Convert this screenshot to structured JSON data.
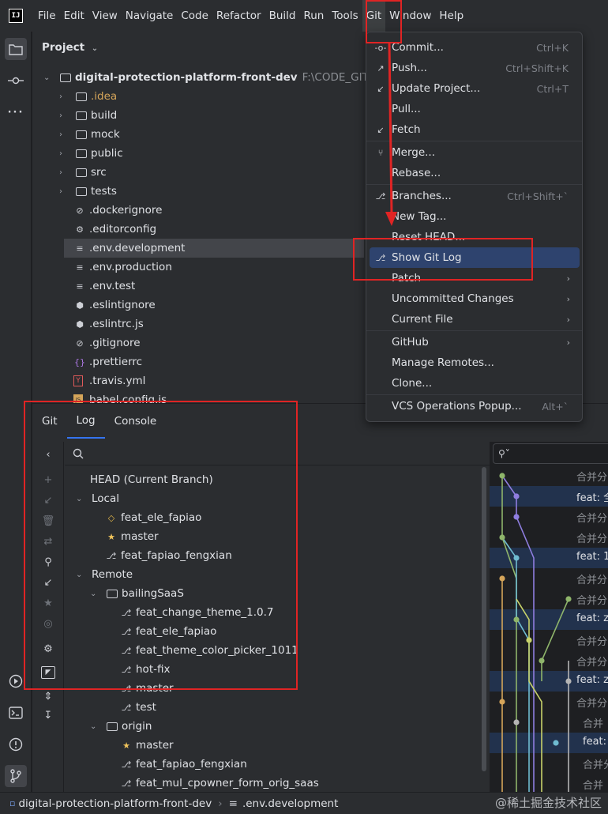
{
  "menubar": {
    "logo": "IJ",
    "items": [
      "File",
      "Edit",
      "View",
      "Navigate",
      "Code",
      "Refactor",
      "Build",
      "Run",
      "Tools",
      "Git",
      "Window",
      "Help"
    ]
  },
  "project": {
    "title": "Project",
    "root_name": "digital-protection-platform-front-dev",
    "root_path": "F:\\CODE_GIT\\SaaS-fe",
    "items": [
      {
        "name": ".idea",
        "type": "folder",
        "color": "#d5a55a"
      },
      {
        "name": "build",
        "type": "folder"
      },
      {
        "name": "mock",
        "type": "folder"
      },
      {
        "name": "public",
        "type": "folder"
      },
      {
        "name": "src",
        "type": "folder"
      },
      {
        "name": "tests",
        "type": "folder"
      },
      {
        "name": ".dockerignore",
        "type": "ignore"
      },
      {
        "name": ".editorconfig",
        "type": "gear"
      },
      {
        "name": ".env.development",
        "type": "text",
        "selected": true
      },
      {
        "name": ".env.production",
        "type": "text"
      },
      {
        "name": ".env.test",
        "type": "text"
      },
      {
        "name": ".eslintignore",
        "type": "eslint"
      },
      {
        "name": ".eslintrc.js",
        "type": "eslint"
      },
      {
        "name": ".gitignore",
        "type": "ignore"
      },
      {
        "name": ".prettierrc",
        "type": "braces"
      },
      {
        "name": ".travis.yml",
        "type": "yaml"
      },
      {
        "name": "babel.config.js",
        "type": "js"
      }
    ]
  },
  "git_menu": {
    "items": [
      {
        "label": "Commit...",
        "shortcut": "Ctrl+K",
        "icon": "commit-icon"
      },
      {
        "label": "Push...",
        "shortcut": "Ctrl+Shift+K",
        "icon": "push-icon"
      },
      {
        "label": "Update Project...",
        "shortcut": "Ctrl+T",
        "icon": "update-icon"
      },
      {
        "label": "Pull...",
        "shortcut": ""
      },
      {
        "label": "Fetch",
        "shortcut": "",
        "icon": "fetch-icon"
      },
      {
        "label": "Merge...",
        "shortcut": "",
        "icon": "merge-icon"
      },
      {
        "label": "Rebase...",
        "shortcut": ""
      },
      {
        "label": "Branches...",
        "shortcut": "Ctrl+Shift+`",
        "icon": "branch-icon"
      },
      {
        "label": "New Tag...",
        "shortcut": ""
      },
      {
        "label": "Reset HEAD...",
        "shortcut": ""
      },
      {
        "label": "Show Git Log",
        "shortcut": "",
        "icon": "branch-icon",
        "highlighted": true
      },
      {
        "label": "Patch",
        "submenu": true
      },
      {
        "label": "Uncommitted Changes",
        "submenu": true
      },
      {
        "label": "Current File",
        "submenu": true
      },
      {
        "label": "GitHub",
        "submenu": true
      },
      {
        "label": "Manage Remotes...",
        "shortcut": ""
      },
      {
        "label": "Clone...",
        "shortcut": ""
      },
      {
        "label": "VCS Operations Popup...",
        "shortcut": "Alt+`"
      }
    ]
  },
  "git_window": {
    "tabs": [
      "Git",
      "Log",
      "Console"
    ],
    "head": "HEAD (Current Branch)",
    "local_label": "Local",
    "local_branches": [
      {
        "name": "feat_ele_fapiao",
        "icon": "tag"
      },
      {
        "name": "master",
        "icon": "star"
      },
      {
        "name": "feat_fapiao_fengxian",
        "icon": "branch"
      }
    ],
    "remote_label": "Remote",
    "remote_groups": [
      {
        "name": "bailingSaaS",
        "branches": [
          {
            "name": "feat_change_theme_1.0.7",
            "icon": "branch"
          },
          {
            "name": "feat_ele_fapiao",
            "icon": "branch"
          },
          {
            "name": "feat_theme_color_picker_1011",
            "icon": "branch"
          },
          {
            "name": "hot-fix",
            "icon": "branch"
          },
          {
            "name": "master",
            "icon": "branch"
          },
          {
            "name": "test",
            "icon": "branch"
          }
        ]
      },
      {
        "name": "origin",
        "branches": [
          {
            "name": "master",
            "icon": "star"
          },
          {
            "name": "feat_fapiao_fengxian",
            "icon": "branch"
          },
          {
            "name": "feat_mul_cpowner_form_orig_saas",
            "icon": "branch"
          }
        ]
      }
    ]
  },
  "log": {
    "rows": [
      {
        "text": "合并分",
        "bright": false
      },
      {
        "text": "feat: 全",
        "bright": true
      },
      {
        "text": "合并分",
        "bright": false
      },
      {
        "text": "合并分",
        "bright": false
      },
      {
        "text": "feat: 1",
        "bright": true
      },
      {
        "text": "合并分",
        "bright": false
      },
      {
        "text": "合并分",
        "bright": false
      },
      {
        "text": "feat: z",
        "bright": true
      },
      {
        "text": "合并分",
        "bright": false
      },
      {
        "text": "合并分",
        "bright": false
      },
      {
        "text": "feat: z",
        "bright": true
      },
      {
        "text": "合并分",
        "bright": false
      },
      {
        "text": "合并",
        "bright": false
      },
      {
        "text": "feat:",
        "bright": true
      },
      {
        "text": "合并分",
        "bright": false
      },
      {
        "text": "合并",
        "bright": false
      }
    ]
  },
  "statusbar": {
    "project": "digital-protection-platform-front-dev",
    "file": ".env.development"
  },
  "watermark": "@稀土掘金技术社区"
}
